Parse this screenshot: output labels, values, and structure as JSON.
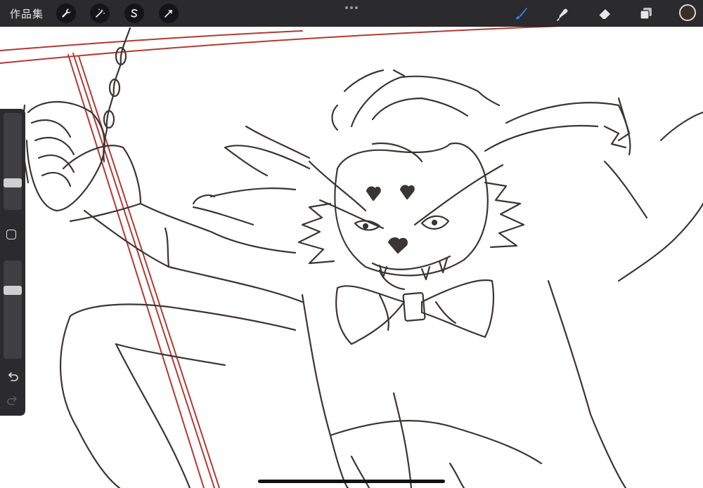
{
  "toolbar": {
    "gallery_label": "作品集",
    "left_tools": [
      {
        "name": "wrench-icon",
        "label": "actions"
      },
      {
        "name": "magic-wand-icon",
        "label": "adjustments"
      },
      {
        "name": "selection-s-icon",
        "label": "selection"
      },
      {
        "name": "arrow-cursor-icon",
        "label": "transform"
      }
    ],
    "right_tools": [
      {
        "name": "brush-icon",
        "active": true
      },
      {
        "name": "smudge-icon",
        "active": false
      },
      {
        "name": "eraser-icon",
        "active": false
      },
      {
        "name": "layers-icon",
        "active": false
      }
    ],
    "active_color": "#3a2e2b",
    "accent_color": "#2f86ee"
  },
  "sidebar": {
    "brush_size_level": 0.26,
    "opacity_level": 0.72,
    "undo_icon": "undo-icon",
    "redo_icon": "redo-icon"
  },
  "canvas": {
    "background": "#ffffff",
    "sketch_color": "#3b3533",
    "guide_color": "#b23a31"
  }
}
